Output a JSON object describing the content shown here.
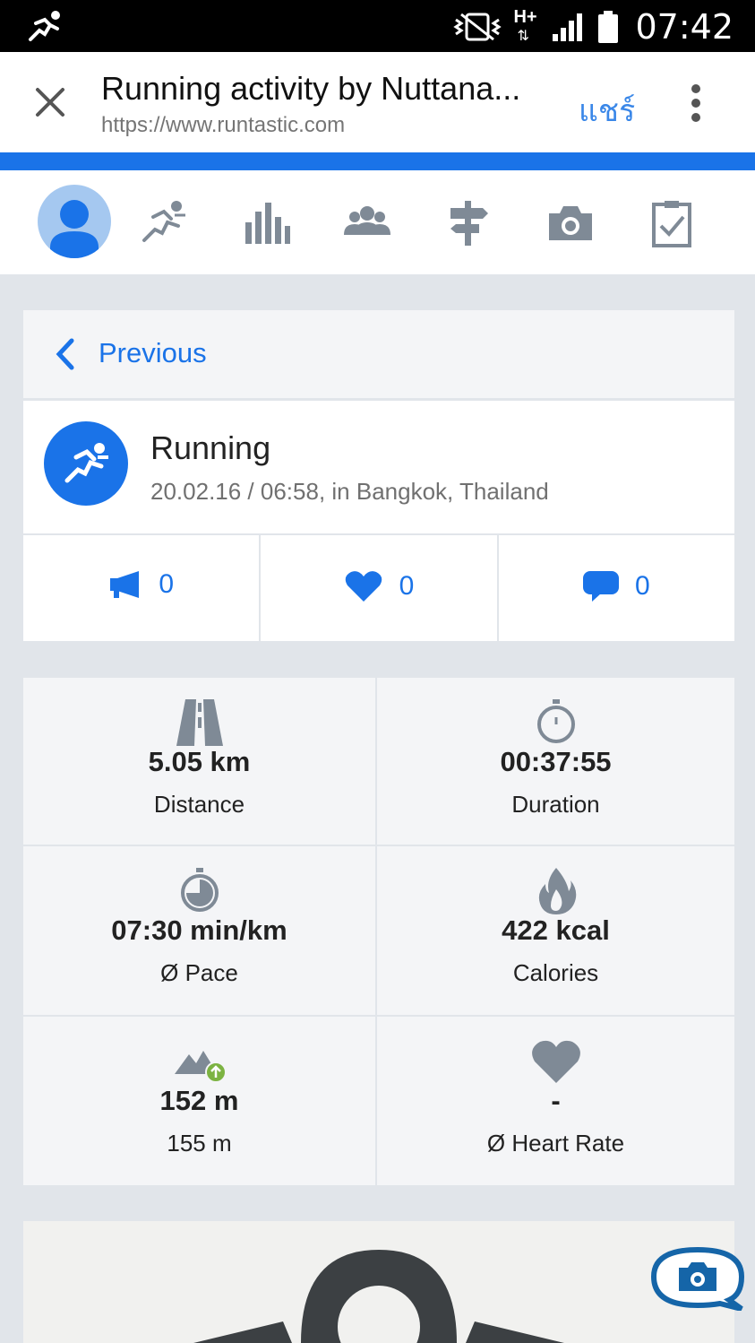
{
  "status_bar": {
    "time": "07:42",
    "network": "H+",
    "icons": [
      "running-icon",
      "vibrate-mute-icon",
      "network-icon",
      "signal-icon",
      "battery-icon"
    ]
  },
  "browser": {
    "title": "Running activity by Nuttana...",
    "url": "https://www.runtastic.com",
    "share_label": "แชร์",
    "accent": "#1a73e8"
  },
  "nav": {
    "items": [
      "avatar",
      "activities-icon",
      "statistics-icon",
      "friends-icon",
      "routes-icon",
      "photos-icon",
      "training-plan-icon"
    ]
  },
  "previous": {
    "label": "Previous"
  },
  "activity": {
    "type": "Running",
    "subtitle": "20.02.16 / 06:58, in Bangkok, Thailand"
  },
  "social": {
    "cheers": "0",
    "likes": "0",
    "comments": "0"
  },
  "stats": [
    {
      "icon": "road-icon",
      "value": "5.05 km",
      "label": "Distance"
    },
    {
      "icon": "stopwatch-icon",
      "value": "00:37:55",
      "label": "Duration"
    },
    {
      "icon": "pace-icon",
      "value": "07:30 min/km",
      "label": "Ø Pace"
    },
    {
      "icon": "flame-icon",
      "value": "422 kcal",
      "label": "Calories"
    },
    {
      "icon": "elevation-icon",
      "value": "152 m",
      "label": "155 m"
    },
    {
      "icon": "heart-icon",
      "value": "-",
      "label": "Ø Heart Rate"
    }
  ],
  "colors": {
    "accent": "#1a73e8",
    "icon_gray": "#7f8a96",
    "elevation_badge": "#7cb342",
    "fab": "#1565a8"
  }
}
